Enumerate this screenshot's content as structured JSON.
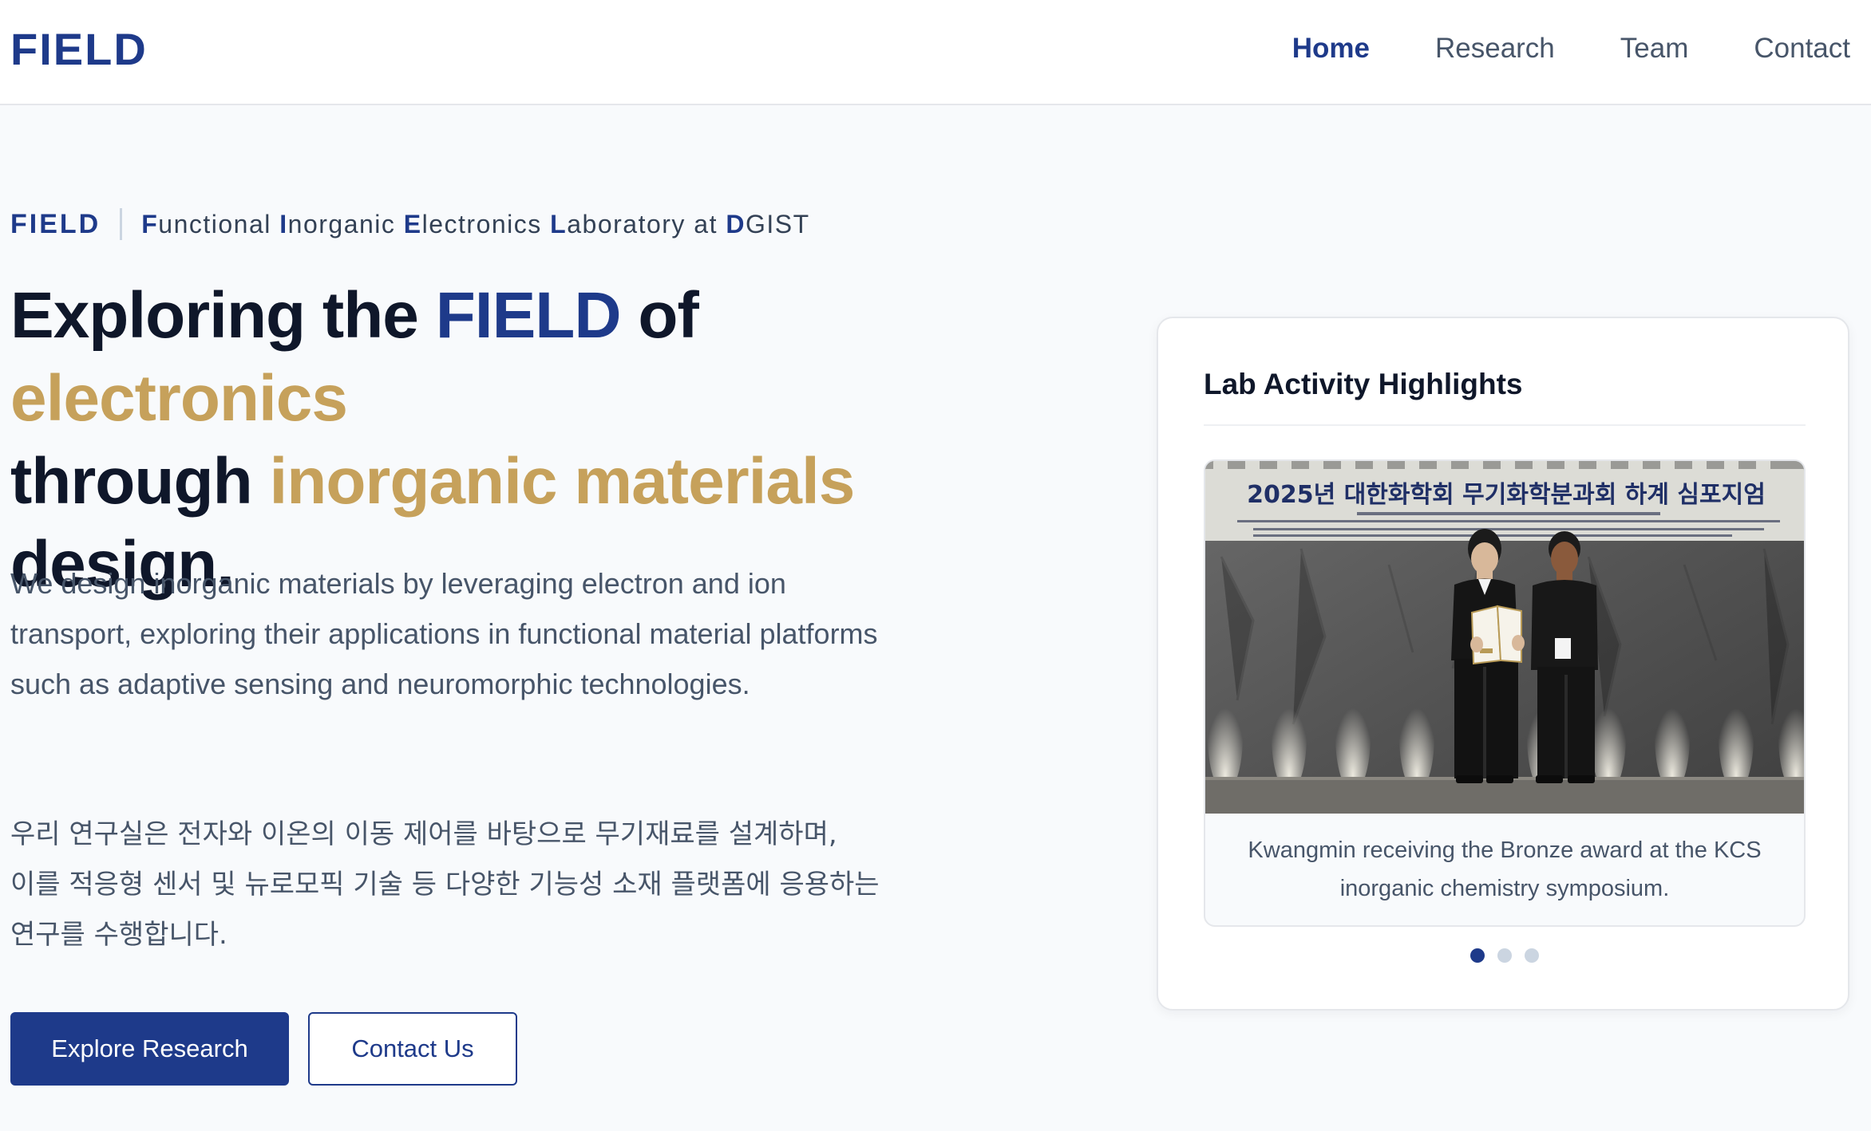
{
  "header": {
    "logo": "FIELD",
    "nav": [
      {
        "label": "Home",
        "active": true
      },
      {
        "label": "Research",
        "active": false
      },
      {
        "label": "Team",
        "active": false
      },
      {
        "label": "Contact",
        "active": false
      }
    ]
  },
  "hero": {
    "eyebrow": {
      "abbr": "FIELD",
      "full_name_parts": [
        {
          "initial": "F",
          "rest": "unctional "
        },
        {
          "initial": "I",
          "rest": "norganic "
        },
        {
          "initial": "E",
          "rest": "lectronics "
        },
        {
          "initial": "L",
          "rest": "aboratory at "
        },
        {
          "initial": "D",
          "rest": "GIST"
        }
      ]
    },
    "headline": {
      "part1": "Exploring the ",
      "part2": "FIELD",
      "part3": " of ",
      "part4": "electronics",
      "part5": "through ",
      "part6": "inorganic materials",
      "part7": "design."
    },
    "intro_en": "We design inorganic materials by leveraging electron and ion transport, exploring their applications in functional material platforms such as adaptive sensing and neuromorphic technologies.",
    "intro_ko_lines": [
      "우리 연구실은 전자와 이온의 이동 제어를 바탕으로 무기재료를 설계하며,",
      "이를 적응형 센서 및 뉴로모픽 기술 등 다양한 기능성 소재 플랫폼에 응용하는",
      "연구를 수행합니다."
    ],
    "buttons": {
      "primary": "Explore Research",
      "secondary": "Contact Us"
    }
  },
  "highlights": {
    "title": "Lab Activity Highlights",
    "banner_text": "2025년 대한화학회 무기화학분과회 하계 심포지엄",
    "caption": "Kwangmin receiving the Bronze award at the KCS inorganic chemistry symposium.",
    "slide_count": 3,
    "active_slide": 1
  },
  "colors": {
    "brand_navy": "#1e3a8a",
    "accent_gold": "#c6a15b",
    "text_dark": "#0f172a",
    "text_muted": "#475569"
  }
}
